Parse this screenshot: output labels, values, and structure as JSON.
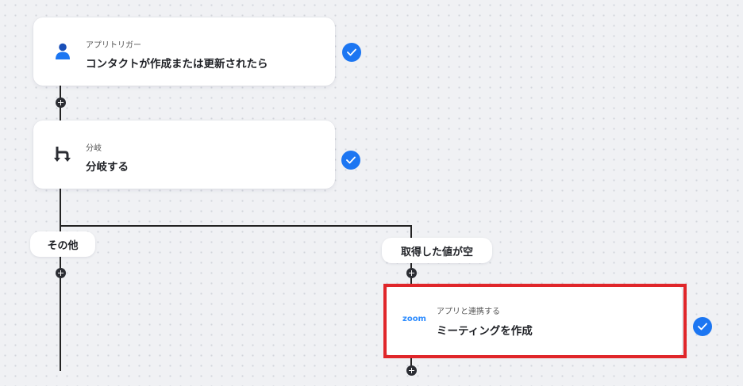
{
  "flow": {
    "step1": {
      "subtitle": "アプリトリガー",
      "title": "コンタクトが作成または更新されたら",
      "icon": "person-icon"
    },
    "step2": {
      "subtitle": "分岐",
      "title": "分岐する",
      "icon": "branch-icon"
    },
    "branch_left": {
      "label": "その他"
    },
    "branch_right": {
      "label": "取得した値が空"
    },
    "step3": {
      "subtitle": "アプリと連携する",
      "title": "ミーティングを作成",
      "icon_text": "zoom",
      "icon": "zoom-logo-icon"
    }
  },
  "colors": {
    "accent": "#1c76f2",
    "highlight": "#e0262a",
    "zoom": "#2d8cff"
  }
}
